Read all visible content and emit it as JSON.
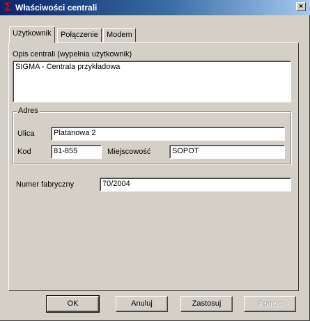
{
  "window": {
    "title": "Właściwości centrali",
    "close_label": "×"
  },
  "tabs": [
    {
      "label": "Użytkownik",
      "active": true
    },
    {
      "label": "Połączenie",
      "active": false
    },
    {
      "label": "Modem",
      "active": false
    }
  ],
  "description": {
    "label": "Opis centrali (wypełnia użytkownik)",
    "value": "SIGMA - Centrala przykładowa"
  },
  "address": {
    "group_label": "Adres",
    "street_label": "Ulica",
    "street_value": "Platanowa 2",
    "postcode_label": "Kod",
    "postcode_value": "81-855",
    "city_label": "Miejscowość",
    "city_value": "SOPOT"
  },
  "serial": {
    "label": "Numer fabryczny",
    "value": "70/2004"
  },
  "buttons": {
    "ok": "OK",
    "cancel": "Anuluj",
    "apply": "Zastosuj",
    "help": "Pomoc"
  },
  "colors": {
    "title_gradient_start": "#0a246a",
    "title_gradient_end": "#a6caf0",
    "face": "#d4d0c8",
    "title_icon": "#e40000"
  },
  "icons": {
    "title": "sigma-icon",
    "close": "close-icon"
  }
}
